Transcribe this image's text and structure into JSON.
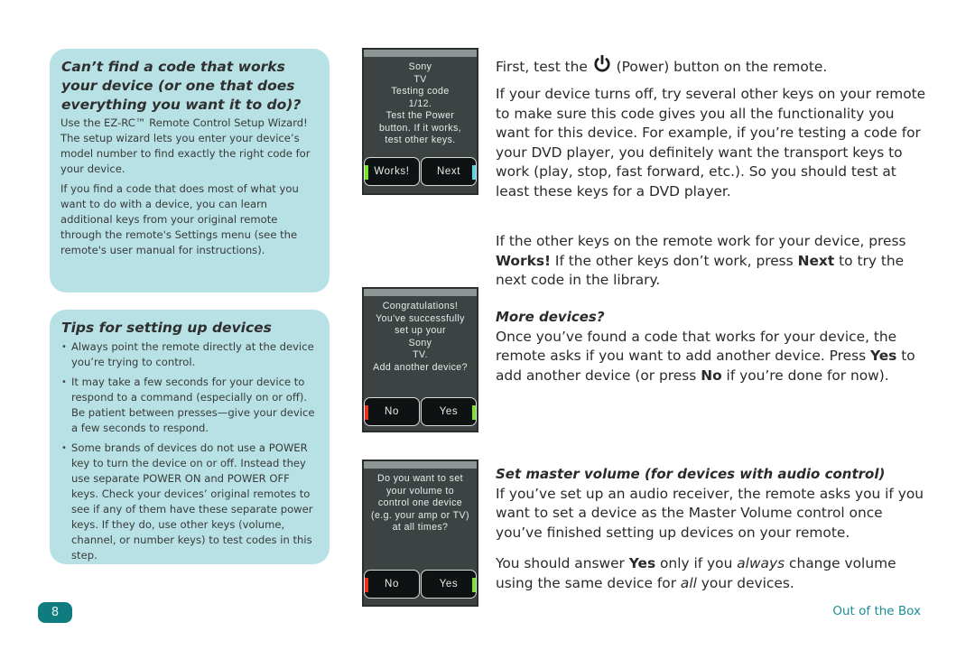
{
  "colors": {
    "callout_bg": "#b7e1e4",
    "accent_teal": "#0f7c80",
    "footer_text": "#1a8e94",
    "screen_bg": "#3c4342",
    "stripe_green": "#7be12a",
    "stripe_cyan": "#5fd3e6",
    "stripe_red": "#e8321f"
  },
  "left": {
    "code_box": {
      "title": "Can’t find a code that works your device (or one that does everything you want it to do)?",
      "paragraphs": [
        "Use the EZ-RC™ Remote Control Setup Wizard! The setup wizard lets you enter your device’s model number to find exactly the right code for your device.",
        "If you find a code that does most of what you want to do with a device, you can learn additional keys from your original remote through the remote's Settings menu (see the remote's user manual for instructions)."
      ]
    },
    "tips_box": {
      "title": "Tips for setting up devices",
      "bullets": [
        "Always point the remote directly at the device you’re trying to control.",
        "It may take a few seconds for your device to respond to a command (especially on or off). Be patient between presses—give your device a few seconds to respond.",
        "Some brands of devices do not use a POWER key to turn the device on or off. Instead they use separate POWER ON and POWER OFF keys. Check your devices’ original remotes to see if any of them have these separate power keys. If they do, use other keys (volume, channel, or number keys) to test codes in this step."
      ]
    }
  },
  "screens": [
    {
      "lines": [
        "Sony",
        "TV",
        "Testing code",
        "1/12.",
        "Test the Power",
        "button. If it works,",
        "test other keys."
      ],
      "buttons": [
        {
          "label": "Works!",
          "stripe": "left",
          "stripe_color": "#7be12a"
        },
        {
          "label": "Next",
          "stripe": "right",
          "stripe_color": "#5fd3e6"
        }
      ]
    },
    {
      "lines": [
        "Congratulations!",
        "You've successfully",
        "set up your",
        "Sony",
        "TV.",
        "Add another device?"
      ],
      "buttons": [
        {
          "label": "No",
          "stripe": "left",
          "stripe_color": "#e8321f"
        },
        {
          "label": "Yes",
          "stripe": "right",
          "stripe_color": "#7be12a"
        }
      ]
    },
    {
      "lines": [
        "Do you want to set",
        "your volume to",
        "control one device",
        "(e.g. your amp or TV)",
        "at all times?"
      ],
      "buttons": [
        {
          "label": "No",
          "stripe": "left",
          "stripe_color": "#e8321f"
        },
        {
          "label": "Yes",
          "stripe": "right",
          "stripe_color": "#7be12a"
        }
      ]
    }
  ],
  "right": {
    "first_before": "First, test the ",
    "power_icon": "power-icon",
    "first_after": " (Power) button on the remote.",
    "turns_off": "If your device turns off, try several other keys on your remote to make sure this code gives you all the functionality you want for this device. For example, if you’re testing a code for your DVD player, you definitely want the transport keys to work (play, stop, fast forward, etc.). So you should test at least these keys for a DVD player.",
    "other_keys": {
      "t1": "If the other keys on the remote work for your device, press ",
      "b1": "Works!",
      "t2": " If the other keys don’t work, press ",
      "b2": "Next",
      "t3": " to try the next code in the library."
    },
    "more_devices": {
      "heading": "More devices?",
      "t1": "Once you’ve found a code that works for your device, the remote asks if you want to add another device. Press ",
      "b1": "Yes",
      "t2": " to add another device (or press ",
      "b2": "No",
      "t3": " if you’re done for now)."
    },
    "master_volume": {
      "heading": "Set master volume (for devices with audio control)",
      "body": "If you’ve set up an audio receiver, the remote asks you if you want to set a device as the Master Volume control once you’ve finished setting up devices on your remote."
    },
    "answer_yes": {
      "t1": "You should answer ",
      "b1": "Yes",
      "t2": " only if you ",
      "i1": "always",
      "t3": " change volume using the same device for ",
      "i2": "all",
      "t4": " your devices."
    }
  },
  "footer": {
    "page_number": "8",
    "section": "Out of the Box"
  }
}
